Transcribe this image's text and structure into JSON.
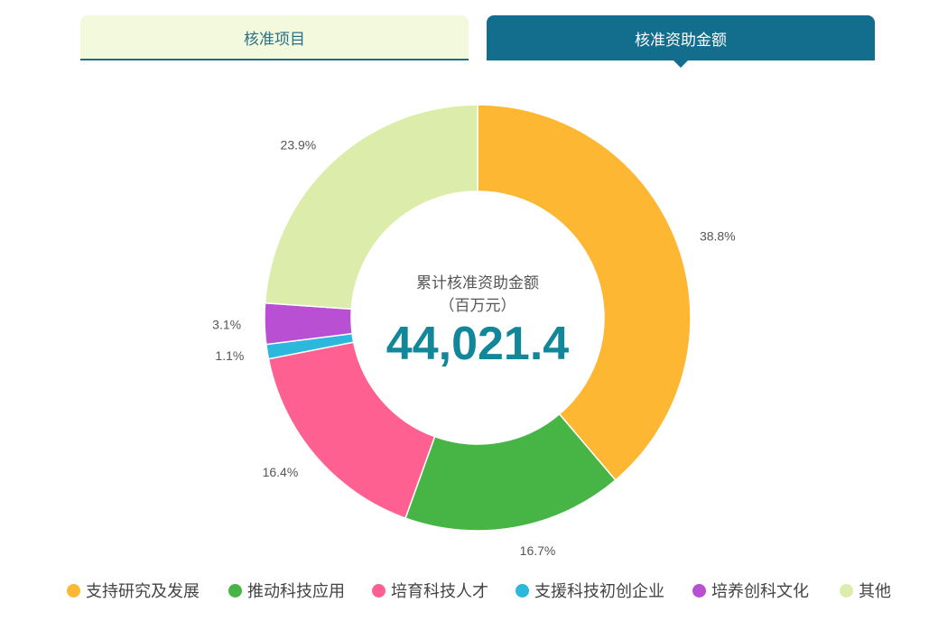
{
  "tabs": [
    {
      "label": "核准项目",
      "active": false
    },
    {
      "label": "核准资助金额",
      "active": true
    }
  ],
  "center": {
    "label_line1": "累计核准资助金额",
    "label_line2": "（百万元）",
    "value": "44,021.4"
  },
  "colors": {
    "tab_active": "#136d8d",
    "tab_inactive": "#f2f9dc",
    "center_value": "#13879a"
  },
  "chart_data": {
    "type": "pie",
    "donut": true,
    "total": 44021.4,
    "unit": "百万元",
    "categories": [
      "支持研究及发展",
      "推动科技应用",
      "培育科技人才",
      "支援科技初创企业",
      "培养创科文化",
      "其他"
    ],
    "values": [
      38.8,
      16.7,
      16.4,
      1.1,
      3.1,
      23.9
    ],
    "labels": [
      "38.8%",
      "16.7%",
      "16.4%",
      "1.1%",
      "3.1%",
      "23.9%"
    ],
    "colors": [
      "#fdb733",
      "#47b446",
      "#fe6092",
      "#2cb8dc",
      "#b94fd3",
      "#dcedab"
    ],
    "legend_position": "bottom"
  }
}
